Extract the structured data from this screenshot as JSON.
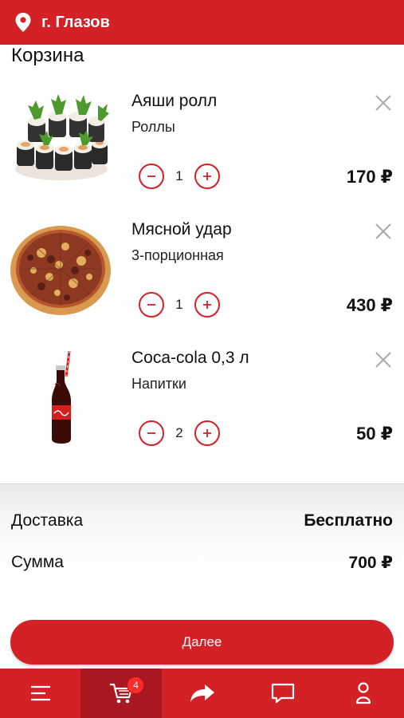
{
  "header": {
    "city": "г. Глазов"
  },
  "page_title": "Корзина",
  "cart_items": [
    {
      "name": "Аяши ролл",
      "category": "Роллы",
      "quantity": "1",
      "price": "170 ₽",
      "image": "sushi-rolls"
    },
    {
      "name": "Мясной удар",
      "category": "3-порционная",
      "quantity": "1",
      "price": "430 ₽",
      "image": "pizza"
    },
    {
      "name": "Coca-cola 0,3 л",
      "category": "Напитки",
      "quantity": "2",
      "price": "50 ₽",
      "image": "coca-cola-bottle"
    }
  ],
  "summary": {
    "delivery_label": "Доставка",
    "delivery_value": "Бесплатно",
    "total_label": "Сумма",
    "total_value": "700 ₽"
  },
  "next_button_label": "Далее",
  "tabbar": {
    "cart_badge": "4",
    "tabs": [
      "menu-icon",
      "cart-icon",
      "share-icon",
      "chat-icon",
      "profile-icon"
    ],
    "active_tab": "cart-icon"
  },
  "colors": {
    "accent": "#d42027",
    "accent_dark": "#a91820"
  }
}
